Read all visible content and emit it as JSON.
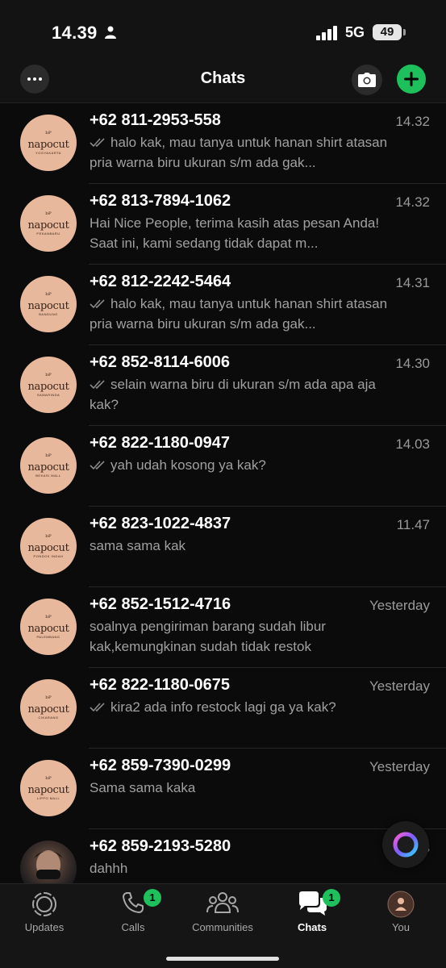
{
  "status_bar": {
    "time": "14.39",
    "network": "5G",
    "battery": "49"
  },
  "header": {
    "title": "Chats"
  },
  "chats": [
    {
      "name": "+62 811-2953-558",
      "time": "14.32",
      "ticks": true,
      "preview": "halo kak, mau tanya untuk hanan shirt atasan pria warna biru ukuran s/m ada gak...",
      "avatar": {
        "mono": "ᵇᴾ",
        "brand": "napocut",
        "sub": "YOGYAKARTA"
      }
    },
    {
      "name": "+62 813-7894-1062",
      "time": "14.32",
      "ticks": false,
      "preview": "Hai Nice People, terima kasih atas pesan Anda! Saat ini, kami sedang tidak dapat m...",
      "avatar": {
        "mono": "ᵇᴾ",
        "brand": "napocut",
        "sub": "PEKANBARU"
      }
    },
    {
      "name": "+62 812-2242-5464",
      "time": "14.31",
      "ticks": true,
      "preview": "halo kak, mau tanya untuk hanan shirt atasan pria warna biru ukuran s/m ada gak...",
      "avatar": {
        "mono": "ᵇᴾ",
        "brand": "napocut",
        "sub": "BANDUNG"
      }
    },
    {
      "name": "+62 852-8114-6006",
      "time": "14.30",
      "ticks": true,
      "preview": "selain warna biru di ukuran s/m ada apa aja kak?",
      "avatar": {
        "mono": "ᵇᴾ",
        "brand": "napocut",
        "sub": "SAMARINDA"
      }
    },
    {
      "name": "+62 822-1180-0947",
      "time": "14.03",
      "ticks": true,
      "preview": "yah udah kosong ya kak?",
      "avatar": {
        "mono": "ᵇᴾ",
        "brand": "napocut",
        "sub": "BEKASI MALL"
      }
    },
    {
      "name": "+62 823-1022-4837",
      "time": "11.47",
      "ticks": false,
      "preview": "sama sama kak",
      "avatar": {
        "mono": "ᵇᴾ",
        "brand": "napocut",
        "sub": "PONDOK INDAH"
      }
    },
    {
      "name": "+62 852-1512-4716",
      "time": "Yesterday",
      "ticks": false,
      "preview": "soalnya pengiriman barang sudah libur kak,kemungkinan sudah tidak restok",
      "avatar": {
        "mono": "ᵇᴾ",
        "brand": "napocut",
        "sub": "PALEMBANG"
      }
    },
    {
      "name": "+62 822-1180-0675",
      "time": "Yesterday",
      "ticks": true,
      "preview": "kira2 ada info restock lagi ga ya kak?",
      "avatar": {
        "mono": "ᵇᴾ",
        "brand": "napocut",
        "sub": "CIKARANG"
      }
    },
    {
      "name": "+62 859-7390-0299",
      "time": "Yesterday",
      "ticks": false,
      "preview": "Sama sama kaka",
      "avatar": {
        "mono": "ᵇᴾ",
        "brand": "napocut",
        "sub": "LIPPO MALL"
      }
    },
    {
      "name": "+62 859-2193-5280",
      "time": "Yes",
      "ticks": false,
      "preview": "dahhh",
      "avatar": {
        "photo": true
      }
    }
  ],
  "tabs": [
    {
      "label": "Updates",
      "icon": "updates-icon",
      "badge": ""
    },
    {
      "label": "Calls",
      "icon": "phone-icon",
      "badge": "1"
    },
    {
      "label": "Communities",
      "icon": "communities-icon",
      "badge": ""
    },
    {
      "label": "Chats",
      "icon": "chats-icon",
      "badge": "1",
      "active": true
    },
    {
      "label": "You",
      "icon": "profile-icon",
      "badge": ""
    }
  ],
  "colors": {
    "accent": "#1ec05b",
    "avatar_bg": "#e8b89c",
    "background": "#0b0b0b"
  }
}
